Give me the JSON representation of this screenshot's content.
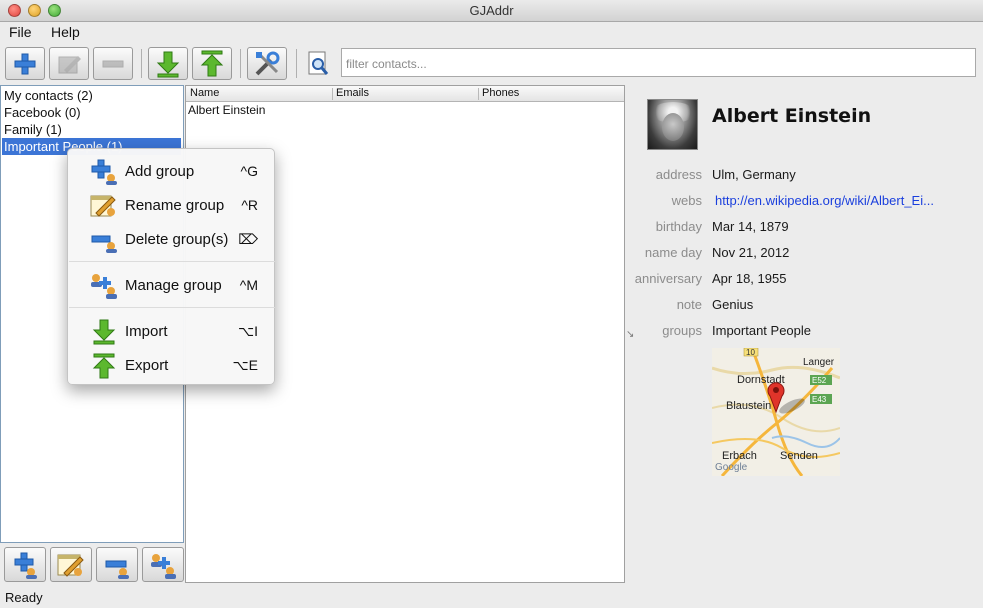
{
  "window": {
    "title": "GJAddr"
  },
  "menubar": {
    "file": "File",
    "help": "Help"
  },
  "toolbar": {
    "buttons": [
      "add-contact",
      "edit-contact",
      "remove-contact",
      "import",
      "export",
      "preferences",
      "search"
    ],
    "search_placeholder": "filter contacts..."
  },
  "groups": {
    "items": [
      {
        "label": "My contacts (2)",
        "selected": false
      },
      {
        "label": "Facebook (0)",
        "selected": false
      },
      {
        "label": "Family (1)",
        "selected": false
      },
      {
        "label": "Important People (1)",
        "selected": true
      }
    ]
  },
  "table": {
    "columns": [
      "Name",
      "Emails",
      "Phones"
    ],
    "rows": [
      {
        "name": "Albert Einstein",
        "emails": "",
        "phones": ""
      }
    ]
  },
  "detail": {
    "name": "Albert Einstein",
    "fields": [
      {
        "label": "address",
        "value": "Ulm, Germany"
      },
      {
        "label": "webs",
        "value": "http://en.wikipedia.org/wiki/Albert_Ei..."
      },
      {
        "label": "birthday",
        "value": "Mar 14, 1879"
      },
      {
        "label": "name day",
        "value": "Nov 21, 2012"
      },
      {
        "label": "anniversary",
        "value": "Apr 18, 1955"
      },
      {
        "label": "note",
        "value": "Genius"
      },
      {
        "label": "groups",
        "value": "Important People"
      }
    ],
    "map_labels": {
      "road_10": "10",
      "langer": "Langer",
      "dornstadt": "Dornstadt",
      "e52": "E52",
      "blaustein": "Blaustein",
      "e43": "E43",
      "erbach": "Erbach",
      "senden": "Senden",
      "google": "Google"
    }
  },
  "context_menu": {
    "items": [
      {
        "label": "Add group",
        "shortcut": "^G",
        "icon": "add-group-icon"
      },
      {
        "label": "Rename group",
        "shortcut": "^R",
        "icon": "rename-group-icon"
      },
      {
        "label": "Delete group(s)",
        "shortcut": "⌦",
        "icon": "delete-group-icon"
      },
      {
        "label": "Manage group",
        "shortcut": "^M",
        "icon": "manage-group-icon"
      },
      {
        "label": "Import",
        "shortcut": "⌥I",
        "icon": "import-icon"
      },
      {
        "label": "Export",
        "shortcut": "⌥E",
        "icon": "export-icon"
      }
    ]
  },
  "status": "Ready",
  "colors": {
    "selection": "#3c75d6",
    "link": "#1a3fdd",
    "accent_green": "#5cb82e",
    "accent_blue": "#3a7fd8"
  }
}
